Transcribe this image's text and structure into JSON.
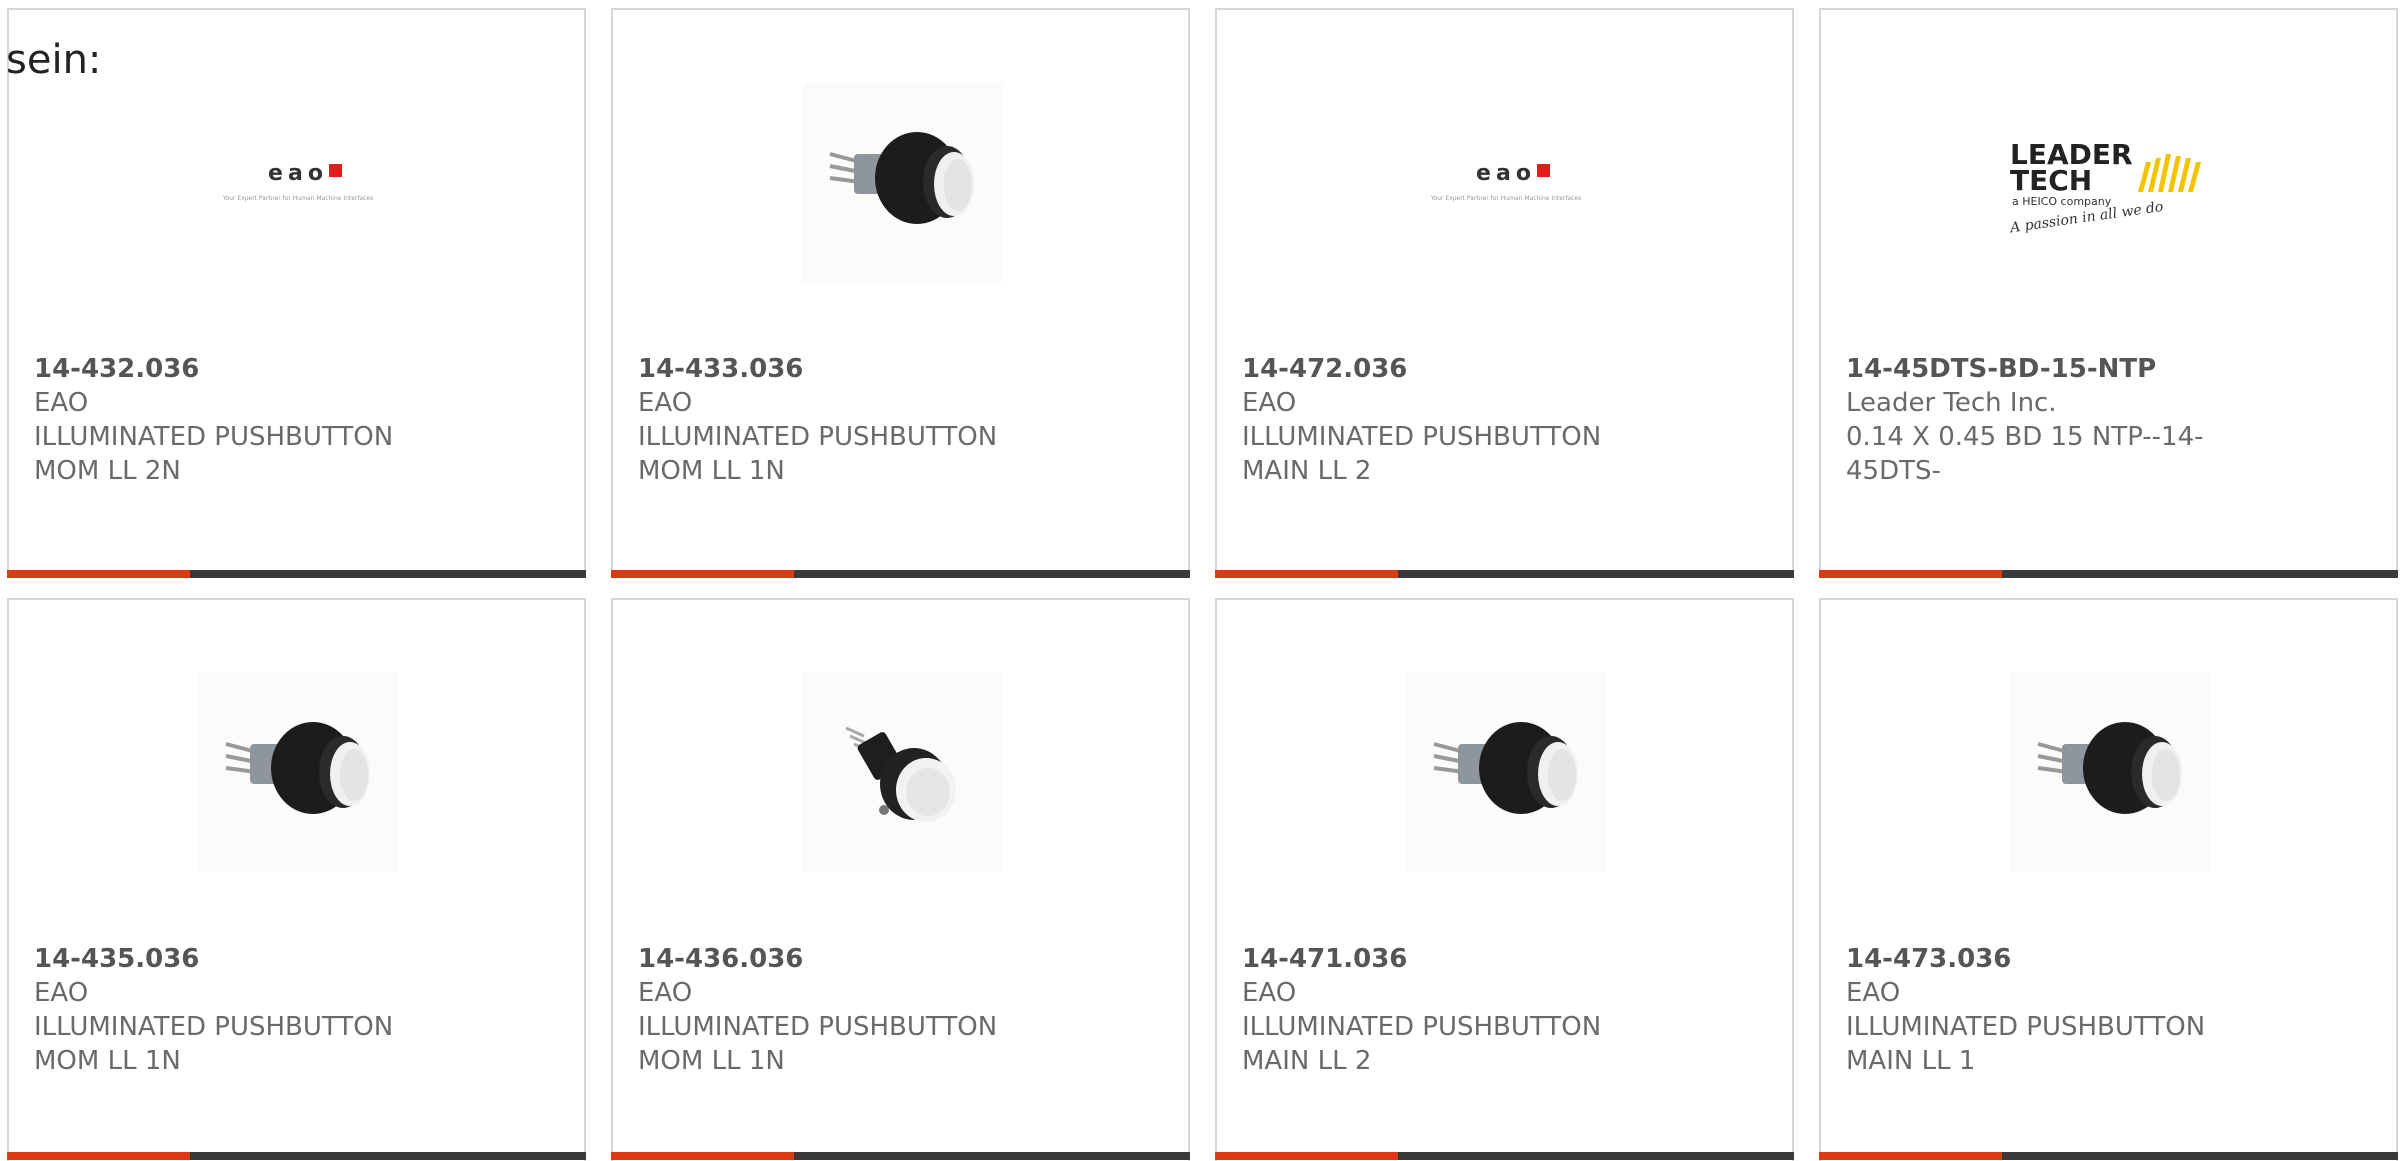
{
  "intro_text": "sein:",
  "colors": {
    "accent_red": "#dc3a14",
    "accent_dark": "#3a3a3a",
    "card_border": "#d6d6d6",
    "text_gray": "#6a6a6a"
  },
  "products": [
    {
      "part_number": "14-432.036",
      "manufacturer": "EAO",
      "description": "ILLUMINATED PUSHBUTTON MOM LL 2N",
      "image": "eao-logo",
      "logo": {
        "brand": "eao",
        "tagline": "Your Expert Partner for Human Machine Interfaces"
      }
    },
    {
      "part_number": "14-433.036",
      "manufacturer": "EAO",
      "description": "ILLUMINATED PUSHBUTTON MOM LL 1N",
      "image": "pushbutton-photo"
    },
    {
      "part_number": "14-472.036",
      "manufacturer": "EAO",
      "description": "ILLUMINATED PUSHBUTTON MAIN LL 2",
      "image": "eao-logo",
      "logo": {
        "brand": "eao",
        "tagline": "Your Expert Partner for Human Machine Interfaces"
      }
    },
    {
      "part_number": "14-45DTS-BD-15-NTP",
      "manufacturer": "Leader Tech Inc.",
      "description": "0.14 X 0.45 BD 15 NTP--14-45DTS-",
      "image": "leadertech-logo",
      "logo": {
        "line1": "LEADER",
        "line2": "TECH",
        "line3": "a HEICO company",
        "line4": "A passion in all we do"
      }
    },
    {
      "part_number": "14-435.036",
      "manufacturer": "EAO",
      "description": "ILLUMINATED PUSHBUTTON MOM LL 1N",
      "image": "pushbutton-photo"
    },
    {
      "part_number": "14-436.036",
      "manufacturer": "EAO",
      "description": "ILLUMINATED PUSHBUTTON MOM LL 1N",
      "image": "pushbutton-small-photo"
    },
    {
      "part_number": "14-471.036",
      "manufacturer": "EAO",
      "description": "ILLUMINATED PUSHBUTTON MAIN LL 2",
      "image": "pushbutton-photo"
    },
    {
      "part_number": "14-473.036",
      "manufacturer": "EAO",
      "description": "ILLUMINATED PUSHBUTTON MAIN LL 1",
      "image": "pushbutton-photo"
    }
  ]
}
